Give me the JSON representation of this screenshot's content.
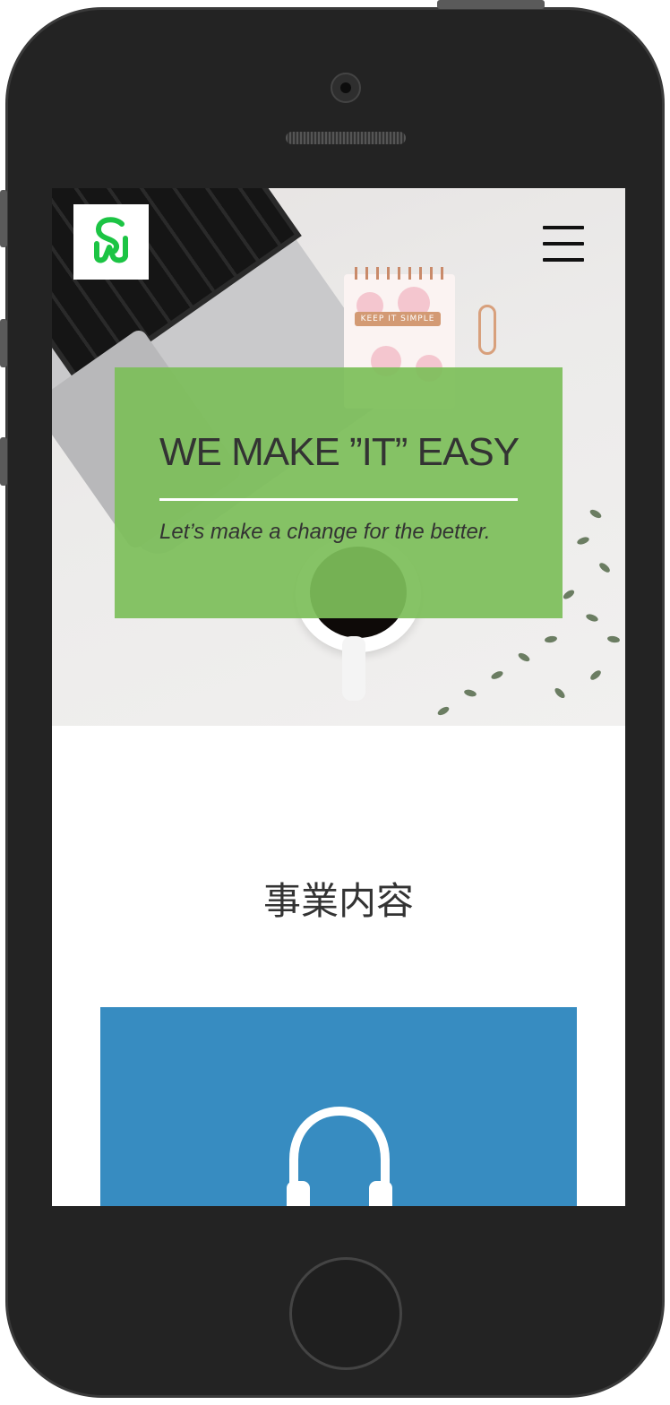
{
  "header": {
    "logo_alt": "SM",
    "menu_icon": "hamburger-menu-icon"
  },
  "hero": {
    "headline": "WE MAKE ”IT” EASY",
    "tagline": "Let’s make a change for the better.",
    "notepad_tag": "KEEP IT SIMPLE"
  },
  "section": {
    "title": "事業内容"
  },
  "service": {
    "icon": "headphones-icon"
  },
  "colors": {
    "banner_green": "#7dbe5a",
    "logo_green": "#1cc444",
    "service_blue": "#378cc1",
    "text_dark": "#333333"
  }
}
